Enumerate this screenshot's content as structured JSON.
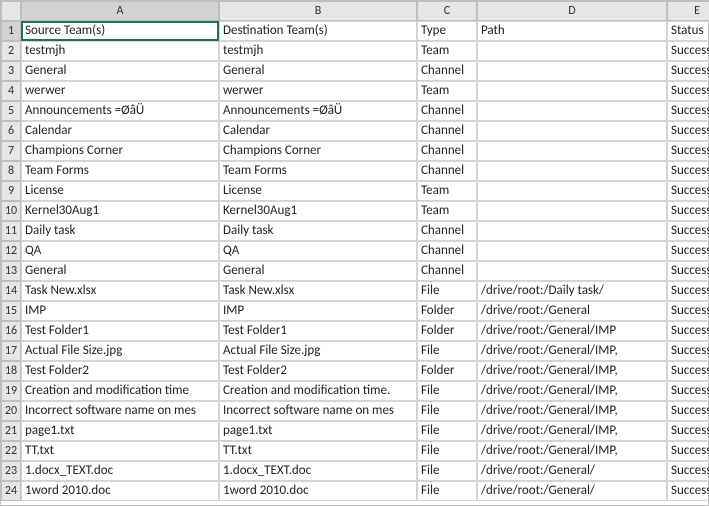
{
  "columns": [
    "A",
    "B",
    "C",
    "D",
    "E"
  ],
  "rowCount": 24,
  "selected": {
    "col": "A",
    "row": 1
  },
  "header": {
    "A": "Source Team(s)",
    "B": "Destination Team(s)",
    "C": "Type",
    "D": "Path",
    "E": "Status"
  },
  "rows": [
    {
      "A": "Source Team(s)",
      "B": "Destination Team(s)",
      "C": "Type",
      "D": "Path",
      "E": "Status"
    },
    {
      "A": "testmjh",
      "B": "testmjh",
      "C": "Team",
      "D": "",
      "E": "Success"
    },
    {
      "A": "General",
      "B": "General",
      "C": "Channel",
      "D": "",
      "E": "Success"
    },
    {
      "A": "werwer",
      "B": "werwer",
      "C": "Team",
      "D": "",
      "E": "Success"
    },
    {
      "A": "Announcements =ØâÜ",
      "B": "Announcements =ØâÜ",
      "C": "Channel",
      "D": "",
      "E": "Success"
    },
    {
      "A": "Calendar",
      "B": "Calendar",
      "C": "Channel",
      "D": "",
      "E": "Success"
    },
    {
      "A": "Champions Corner",
      "B": "Champions Corner",
      "C": "Channel",
      "D": "",
      "E": "Success"
    },
    {
      "A": "Team Forms",
      "B": "Team Forms",
      "C": "Channel",
      "D": "",
      "E": "Success"
    },
    {
      "A": "License",
      "B": "License",
      "C": "Team",
      "D": "",
      "E": "Success"
    },
    {
      "A": "Kernel30Aug1",
      "B": "Kernel30Aug1",
      "C": "Team",
      "D": "",
      "E": "Success"
    },
    {
      "A": "Daily task",
      "B": "Daily task",
      "C": "Channel",
      "D": "",
      "E": "Success"
    },
    {
      "A": "QA",
      "B": "QA",
      "C": "Channel",
      "D": "",
      "E": "Success"
    },
    {
      "A": "General",
      "B": "General",
      "C": "Channel",
      "D": "",
      "E": "Success"
    },
    {
      "A": "Task New.xlsx",
      "B": "Task New.xlsx",
      "C": "File",
      "D": "/drive/root:/Daily task/",
      "E": "Success"
    },
    {
      "A": "IMP",
      "B": "IMP",
      "C": "Folder",
      "D": "/drive/root:/General",
      "E": "Success"
    },
    {
      "A": "Test Folder1",
      "B": "Test Folder1",
      "C": "Folder",
      "D": "/drive/root:/General/IMP",
      "E": "Success"
    },
    {
      "A": "Actual File Size.jpg",
      "B": "Actual File Size.jpg",
      "C": "File",
      "D": "/drive/root:/General/IMP,",
      "E": "Success"
    },
    {
      "A": "Test Folder2",
      "B": "Test Folder2",
      "C": "Folder",
      "D": "/drive/root:/General/IMP,",
      "E": "Success"
    },
    {
      "A": "Creation and modification time",
      "B": "Creation and modification time.",
      "C": "File",
      "D": "/drive/root:/General/IMP,",
      "E": "Success"
    },
    {
      "A": "Incorrect software name on mes",
      "B": "Incorrect software name on mes",
      "C": "File",
      "D": "/drive/root:/General/IMP,",
      "E": "Success"
    },
    {
      "A": "page1.txt",
      "B": "page1.txt",
      "C": "File",
      "D": "/drive/root:/General/IMP,",
      "E": "Success"
    },
    {
      "A": "TT.txt",
      "B": "TT.txt",
      "C": "File",
      "D": "/drive/root:/General/IMP,",
      "E": "Success"
    },
    {
      "A": "1.docx_TEXT.doc",
      "B": "1.docx_TEXT.doc",
      "C": "File",
      "D": "/drive/root:/General/",
      "E": "Success"
    },
    {
      "A": "1word 2010.doc",
      "B": "1word 2010.doc",
      "C": "File",
      "D": "/drive/root:/General/",
      "E": "Success"
    }
  ]
}
